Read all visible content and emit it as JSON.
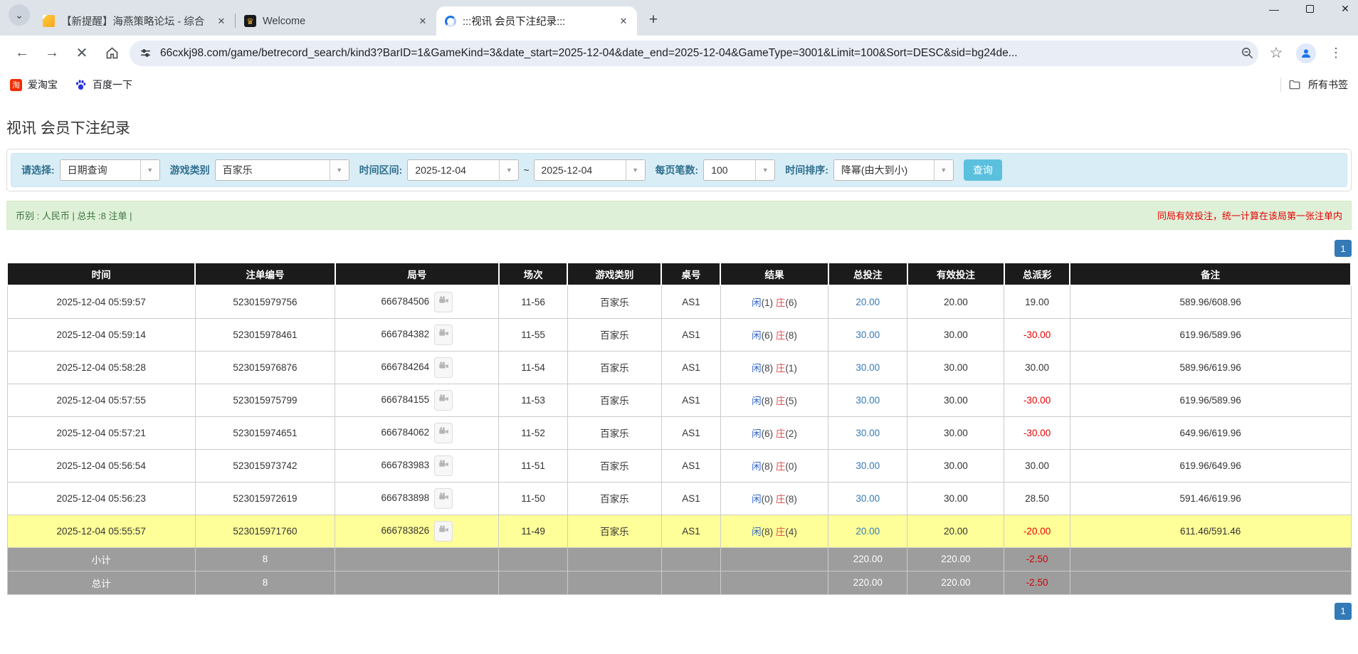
{
  "browser": {
    "tabs": [
      {
        "title": "【新提醒】海燕策略论坛 - 综合",
        "icon": "yellow-doc-icon"
      },
      {
        "title": "Welcome",
        "icon": "dark-lion-icon"
      },
      {
        "title": ":::视讯 会员下注纪录:::",
        "icon": "loading-spinner-icon",
        "active": true
      }
    ],
    "url": "66cxkj98.com/game/betrecord_search/kind3?BarID=1&GameKind=3&date_start=2025-12-04&date_end=2025-12-04&GameType=3001&Limit=100&Sort=DESC&sid=bg24de...",
    "bookmarks": [
      {
        "label": "爱淘宝",
        "icon": "taobao-icon",
        "icon_glyph": "淘"
      },
      {
        "label": "百度一下",
        "icon": "baidu-paw-icon"
      }
    ],
    "all_bookmarks_label": "所有书签"
  },
  "icons": {
    "tab_search_chevron": "⌄",
    "close": "✕",
    "new_tab": "+",
    "back_arrow": "←",
    "forward_arrow": "→",
    "stop": "✕",
    "minimize": "—",
    "menu_dots": "⋮",
    "star": "☆",
    "combo_arrow": "▼",
    "fav_dark_glyph": "♛"
  },
  "page": {
    "title": "视讯 会员下注纪录",
    "filters": {
      "select_label": "请选择:",
      "select_value": "日期查询",
      "game_label": "游戏类别",
      "game_value": "百家乐",
      "date_label": "时间区间:",
      "date_start": "2025-12-04",
      "date_separator": "~",
      "date_end": "2025-12-04",
      "page_size_label": "每页笔数:",
      "page_size_value": "100",
      "sort_label": "时间排序:",
      "sort_value": "降幂(由大到小)",
      "search_button": "查询"
    },
    "info_bar": {
      "left": "币别 : 人民币 | 总共 :8 注单 |",
      "right": "同局有效投注，统一计算在该局第一张注单内"
    },
    "pagination": {
      "page": "1"
    }
  },
  "table": {
    "columns": [
      "时间",
      "注单编号",
      "局号",
      "场次",
      "游戏类别",
      "桌号",
      "结果",
      "总投注",
      "有效投注",
      "总派彩",
      "备注"
    ],
    "result_labels": {
      "player": "闲",
      "banker": "庄"
    },
    "rows": [
      {
        "time": "2025-12-04 05:59:57",
        "bet_id": "523015979756",
        "round": "666784506",
        "session": "11-56",
        "game": "百家乐",
        "table_no": "AS1",
        "player": "1",
        "banker": "6",
        "total_bet": "20.00",
        "valid_bet": "20.00",
        "payout": "19.00",
        "note": "589.96/608.96",
        "highlight": false
      },
      {
        "time": "2025-12-04 05:59:14",
        "bet_id": "523015978461",
        "round": "666784382",
        "session": "11-55",
        "game": "百家乐",
        "table_no": "AS1",
        "player": "6",
        "banker": "8",
        "total_bet": "30.00",
        "valid_bet": "30.00",
        "payout": "-30.00",
        "note": "619.96/589.96",
        "highlight": false
      },
      {
        "time": "2025-12-04 05:58:28",
        "bet_id": "523015976876",
        "round": "666784264",
        "session": "11-54",
        "game": "百家乐",
        "table_no": "AS1",
        "player": "8",
        "banker": "1",
        "total_bet": "30.00",
        "valid_bet": "30.00",
        "payout": "30.00",
        "note": "589.96/619.96",
        "highlight": false
      },
      {
        "time": "2025-12-04 05:57:55",
        "bet_id": "523015975799",
        "round": "666784155",
        "session": "11-53",
        "game": "百家乐",
        "table_no": "AS1",
        "player": "8",
        "banker": "5",
        "total_bet": "30.00",
        "valid_bet": "30.00",
        "payout": "-30.00",
        "note": "619.96/589.96",
        "highlight": false
      },
      {
        "time": "2025-12-04 05:57:21",
        "bet_id": "523015974651",
        "round": "666784062",
        "session": "11-52",
        "game": "百家乐",
        "table_no": "AS1",
        "player": "6",
        "banker": "2",
        "total_bet": "30.00",
        "valid_bet": "30.00",
        "payout": "-30.00",
        "note": "649.96/619.96",
        "highlight": false
      },
      {
        "time": "2025-12-04 05:56:54",
        "bet_id": "523015973742",
        "round": "666783983",
        "session": "11-51",
        "game": "百家乐",
        "table_no": "AS1",
        "player": "8",
        "banker": "0",
        "total_bet": "30.00",
        "valid_bet": "30.00",
        "payout": "30.00",
        "note": "619.96/649.96",
        "highlight": false
      },
      {
        "time": "2025-12-04 05:56:23",
        "bet_id": "523015972619",
        "round": "666783898",
        "session": "11-50",
        "game": "百家乐",
        "table_no": "AS1",
        "player": "0",
        "banker": "8",
        "total_bet": "30.00",
        "valid_bet": "30.00",
        "payout": "28.50",
        "note": "591.46/619.96",
        "highlight": false
      },
      {
        "time": "2025-12-04 05:55:57",
        "bet_id": "523015971760",
        "round": "666783826",
        "session": "11-49",
        "game": "百家乐",
        "table_no": "AS1",
        "player": "8",
        "banker": "4",
        "total_bet": "20.00",
        "valid_bet": "20.00",
        "payout": "-20.00",
        "note": "611.46/591.46",
        "highlight": true
      }
    ],
    "summary_rows": [
      {
        "label": "小计",
        "count": "8",
        "total_bet": "220.00",
        "valid_bet": "220.00",
        "payout": "-2.50"
      },
      {
        "label": "总计",
        "count": "8",
        "total_bet": "220.00",
        "valid_bet": "220.00",
        "payout": "-2.50"
      }
    ]
  },
  "colors": {
    "link_blue": "#337ab7",
    "player_blue": "#3366cc",
    "banker_red": "#d9534f",
    "negative_red": "#e60000",
    "highlight_yellow": "#ffff99",
    "filter_bg": "#d9edf7",
    "info_bg": "#dff0d8",
    "header_black": "#1b1b1b",
    "summary_gray": "#9d9d9d",
    "search_button_blue": "#5bc0de"
  }
}
